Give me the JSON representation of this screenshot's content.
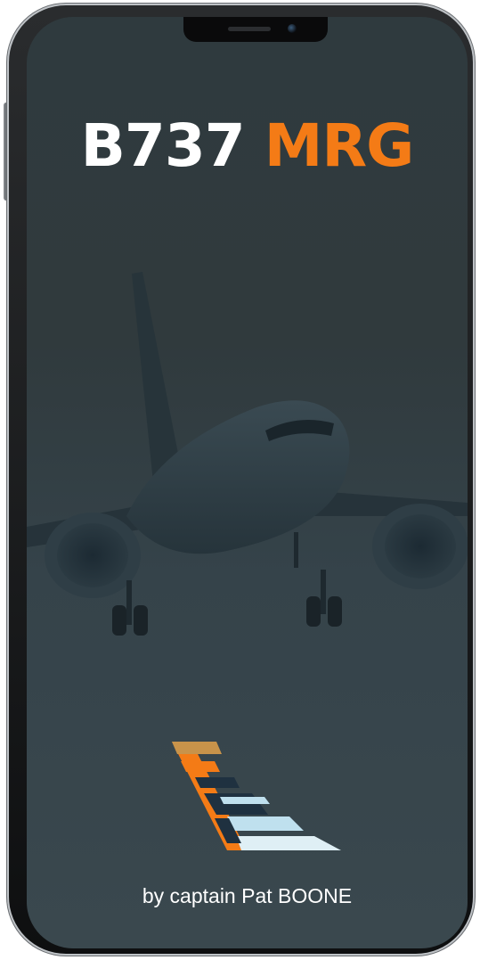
{
  "app": {
    "title_part1": "B737",
    "title_part2": "MRG",
    "credit": "by captain Pat BOONE"
  },
  "colors": {
    "accent_orange": "#f47b16",
    "title_white": "#ffffff",
    "background": "#303a3d",
    "logo_navy": "#1f3140",
    "logo_light_blue": "#bfe0ee",
    "logo_gold": "#c8934a"
  },
  "icons": {
    "airplane": "airplane-landing-illustration",
    "logo": "tail-fin-logo"
  }
}
